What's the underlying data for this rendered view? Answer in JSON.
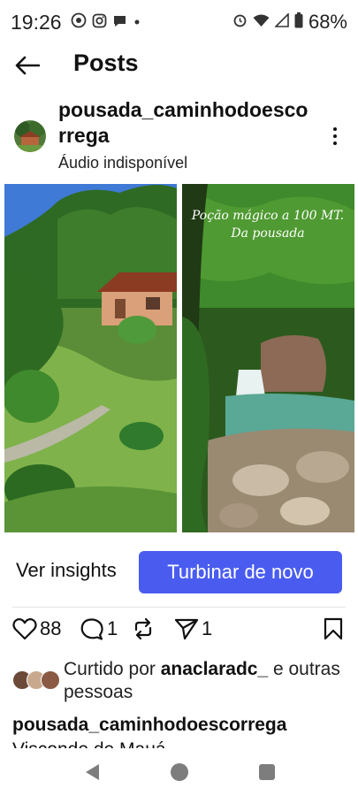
{
  "status_bar": {
    "time": "19:26",
    "battery": "68%",
    "left_icons": [
      "whatsapp-icon",
      "instagram-icon",
      "message-icon",
      "dot-icon"
    ],
    "right_icons": [
      "alarm-icon",
      "wifi-icon",
      "signal-icon",
      "battery-icon"
    ]
  },
  "header": {
    "title": "Posts",
    "back_icon": "back-arrow-icon"
  },
  "post": {
    "account_name": "pousada_caminhodoescorrega",
    "audio_note": "Áudio indisponível",
    "more_icon": "more-vertical-icon",
    "image_overlay_text": [
      "Poção  mágico a 100 MT.",
      "Da pousada"
    ]
  },
  "actions": {
    "insights_label": "Ver insights",
    "boost_label": "Turbinar de novo",
    "boost_color": "#4a5cf0"
  },
  "engagement": {
    "likes": "88",
    "comments": "1",
    "reposts": "",
    "shares": "1"
  },
  "liked_by": {
    "prefix": "Curtido por ",
    "user": "anaclaradc_",
    "suffix": " e outras pessoas"
  },
  "caption": {
    "username": "pousada_caminhodoescorrega",
    "text": "Visconde de Mauá ..."
  },
  "nav_bar": {
    "back": "nav-back-icon",
    "home": "nav-home-icon",
    "recent": "nav-recent-icon"
  }
}
